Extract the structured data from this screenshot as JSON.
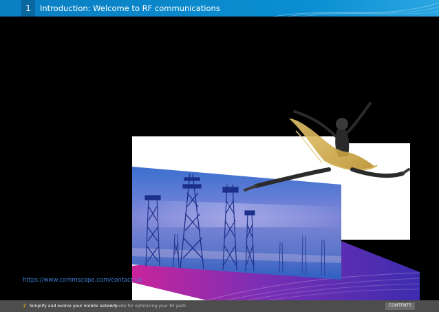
{
  "header": {
    "section_number": "1",
    "title": "Introduction: Welcome to RF communications"
  },
  "main": {
    "link_text": "https://www.commscope.com/contact-us",
    "illustration": "dancer-over-cell-towers"
  },
  "footer": {
    "page_number": "7",
    "doc_title": "Simplify and evolve your mobile network",
    "doc_subtitle": "A guide for optimizing your RF path",
    "contents_label": "CONTENTS"
  },
  "colors": {
    "accent_blue": "#0a8fd2",
    "link_blue": "#3d7fd6",
    "footer_gray": "#4d4d4d",
    "page_number_yellow": "#f2c200"
  }
}
